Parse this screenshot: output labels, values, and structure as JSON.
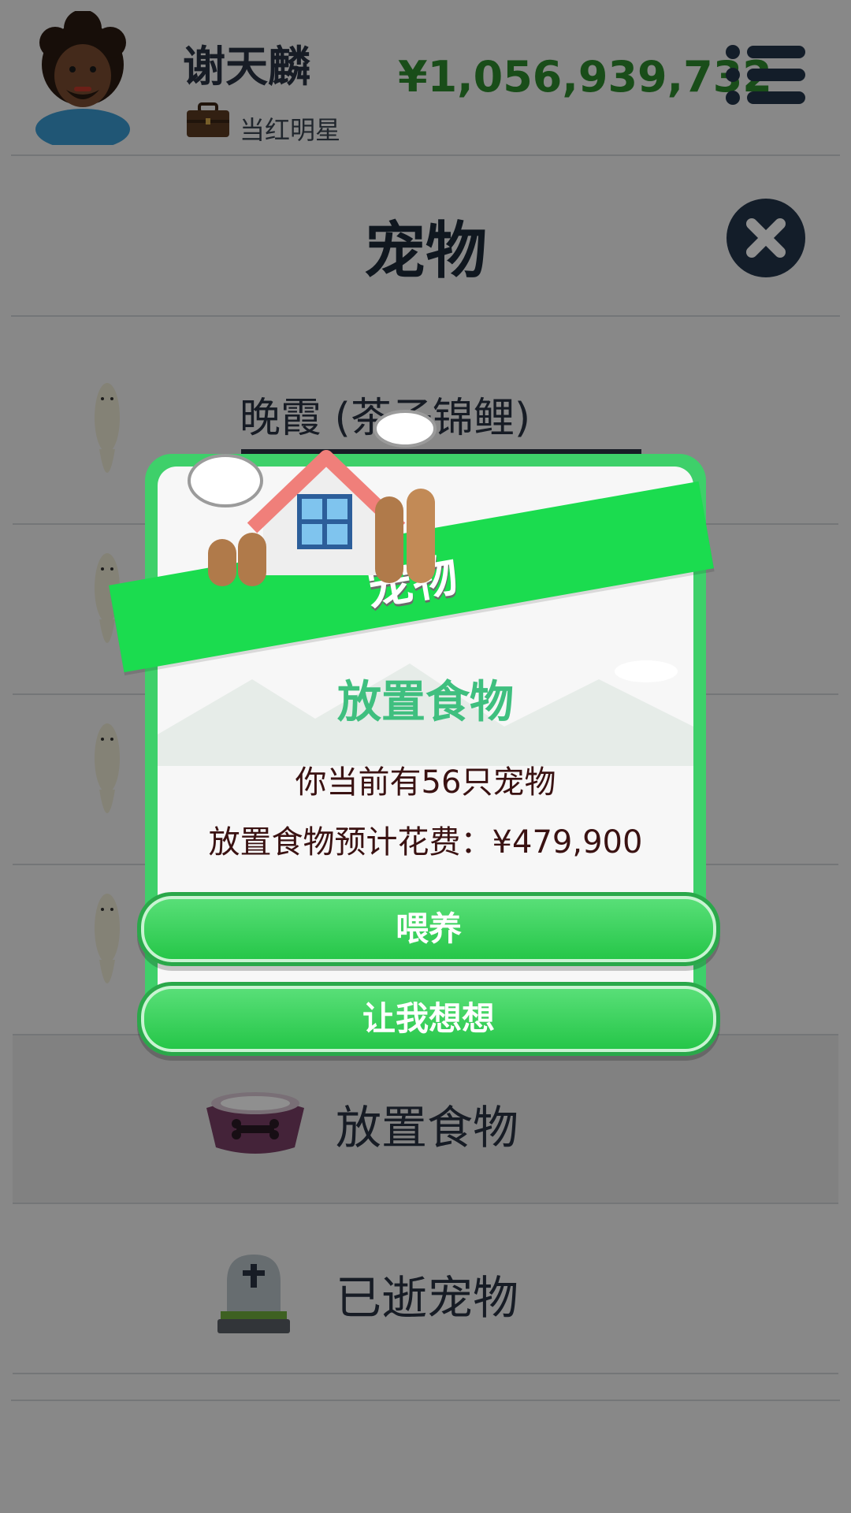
{
  "header": {
    "username": "谢天麟",
    "job_title": "当红明星",
    "money": "¥1,056,939,732"
  },
  "page": {
    "title": "宠物"
  },
  "pets": [
    {
      "name": "晚霞 (茶子锦鲤)"
    },
    {
      "name": ""
    },
    {
      "name": ""
    },
    {
      "name": ""
    }
  ],
  "actions": {
    "feed_label": "放置食物",
    "deceased_label": "已逝宠物"
  },
  "modal": {
    "banner": "宠物",
    "heading": "放置食物",
    "pet_count_text": "你当前有56只宠物",
    "cost_text": "放置食物预计花费：¥479,900",
    "confirm_label": "喂养",
    "cancel_label": "让我想想"
  },
  "colors": {
    "money": "#2e8a2e",
    "modal_frame": "#3ed06a",
    "banner": "#1bdc4f",
    "heading": "#3fbf7f",
    "button": "#23c546"
  }
}
